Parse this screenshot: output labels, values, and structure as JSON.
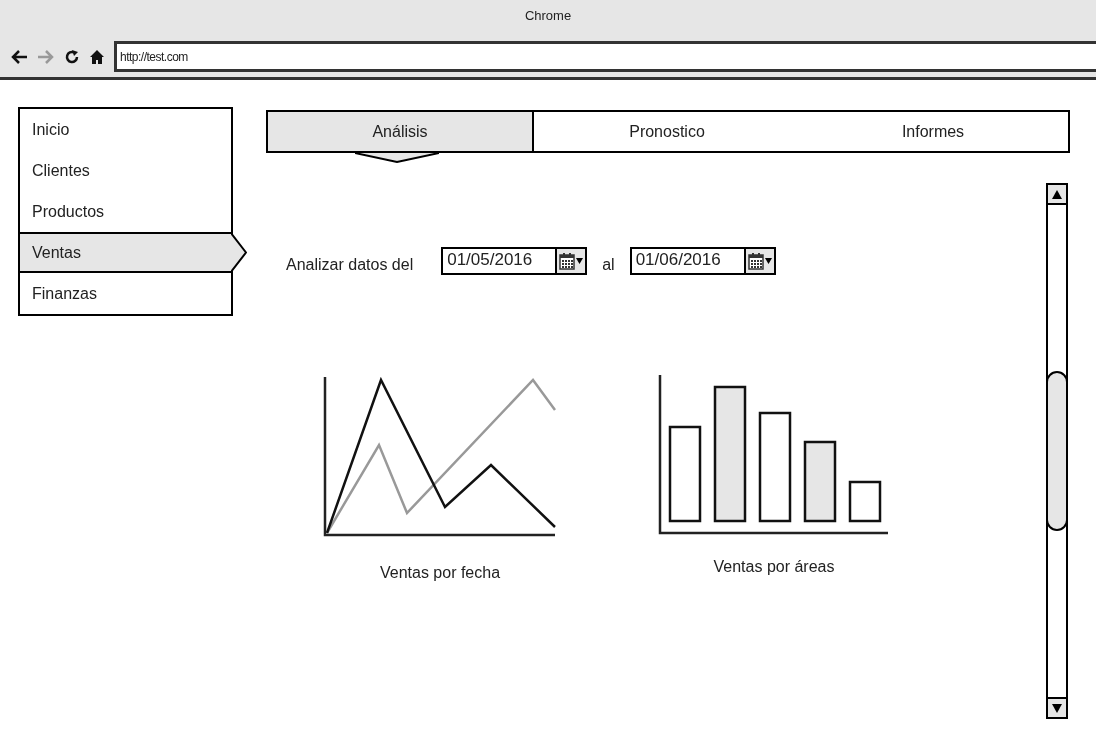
{
  "window": {
    "title": "Chrome"
  },
  "toolbar": {
    "url": "http://test.com"
  },
  "sidebar": {
    "items": [
      {
        "label": "Inicio",
        "selected": false
      },
      {
        "label": "Clientes",
        "selected": false
      },
      {
        "label": "Productos",
        "selected": false
      },
      {
        "label": "Ventas",
        "selected": true
      },
      {
        "label": "Finanzas",
        "selected": false
      }
    ]
  },
  "tabs": [
    {
      "label": "Análisis",
      "selected": true
    },
    {
      "label": "Pronostico",
      "selected": false
    },
    {
      "label": "Informes",
      "selected": false
    }
  ],
  "date_range": {
    "label": "Analizar datos del",
    "from": "01/05/2016",
    "separator": "al",
    "to": "01/06/2016"
  },
  "charts": [
    {
      "kind": "line",
      "caption": "Ventas por fecha"
    },
    {
      "kind": "bar",
      "caption": "Ventas por áreas"
    }
  ]
}
